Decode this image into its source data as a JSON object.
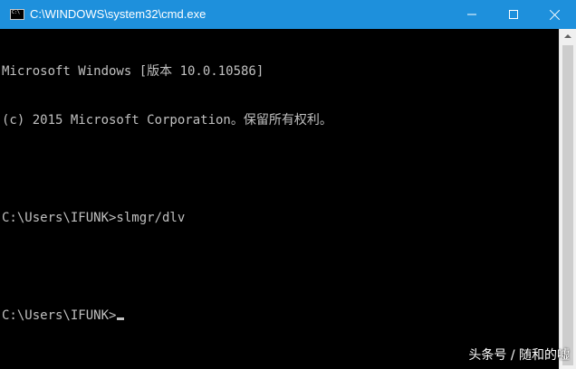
{
  "window": {
    "title": "C:\\WINDOWS\\system32\\cmd.exe",
    "icon": "cmd-icon",
    "accent_color": "#1e90dc",
    "icon_text": "C:\\"
  },
  "controls": {
    "minimize": "minimize-icon",
    "maximize": "maximize-icon",
    "close": "close-icon"
  },
  "console": {
    "lines": [
      "Microsoft Windows [版本 10.0.10586]",
      "(c) 2015 Microsoft Corporation。保留所有权利。",
      "",
      "C:\\Users\\IFUNK>slmgr/dlv",
      "",
      "C:\\Users\\IFUNK>"
    ],
    "text_color": "#c0c0c0",
    "background": "#000000"
  },
  "watermark": {
    "text": "头条号 / 随和的嘘"
  }
}
